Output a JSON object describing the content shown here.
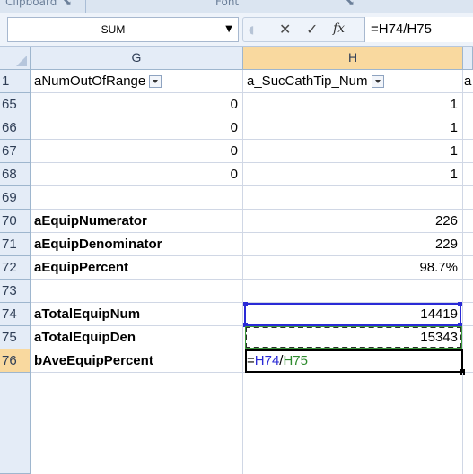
{
  "ribbon": {
    "group1": "Clipboard",
    "group2": "Font"
  },
  "name_box": {
    "value": "SUM"
  },
  "formula_bar": {
    "content": "=H74/H75",
    "cancel": "✕",
    "enter": "✓",
    "fx": "fx"
  },
  "columns": {
    "g": "G",
    "h": "H"
  },
  "header_row": {
    "row_num": "1",
    "g": "aNumOutOfRange",
    "h": "a_SucCathTip_Num",
    "i": "a"
  },
  "rows": [
    {
      "num": "65",
      "g": "0",
      "h": "1"
    },
    {
      "num": "66",
      "g": "0",
      "h": "1"
    },
    {
      "num": "67",
      "g": "0",
      "h": "1"
    },
    {
      "num": "68",
      "g": "0",
      "h": "1"
    },
    {
      "num": "69",
      "g": "",
      "h": ""
    },
    {
      "num": "70",
      "g": "aEquipNumerator",
      "h": "226"
    },
    {
      "num": "71",
      "g": "aEquipDenominator",
      "h": "229"
    },
    {
      "num": "72",
      "g": "aEquipPercent",
      "h": "98.7%"
    },
    {
      "num": "73",
      "g": "",
      "h": ""
    },
    {
      "num": "74",
      "g": "aTotalEquipNum",
      "h": "14419"
    },
    {
      "num": "75",
      "g": "aTotalEquipDen",
      "h": "15343"
    },
    {
      "num": "76",
      "g": "bAveEquipPercent",
      "h": ""
    }
  ],
  "edit_cell": {
    "eq": "=",
    "ref1": "H74",
    "slash": "/",
    "ref2": "H75"
  },
  "colors": {
    "ref1": "#2a2ad6",
    "ref2": "#2e8b2e",
    "selected_header": "#f9d99f",
    "header_bg": "#e4ecf7"
  }
}
